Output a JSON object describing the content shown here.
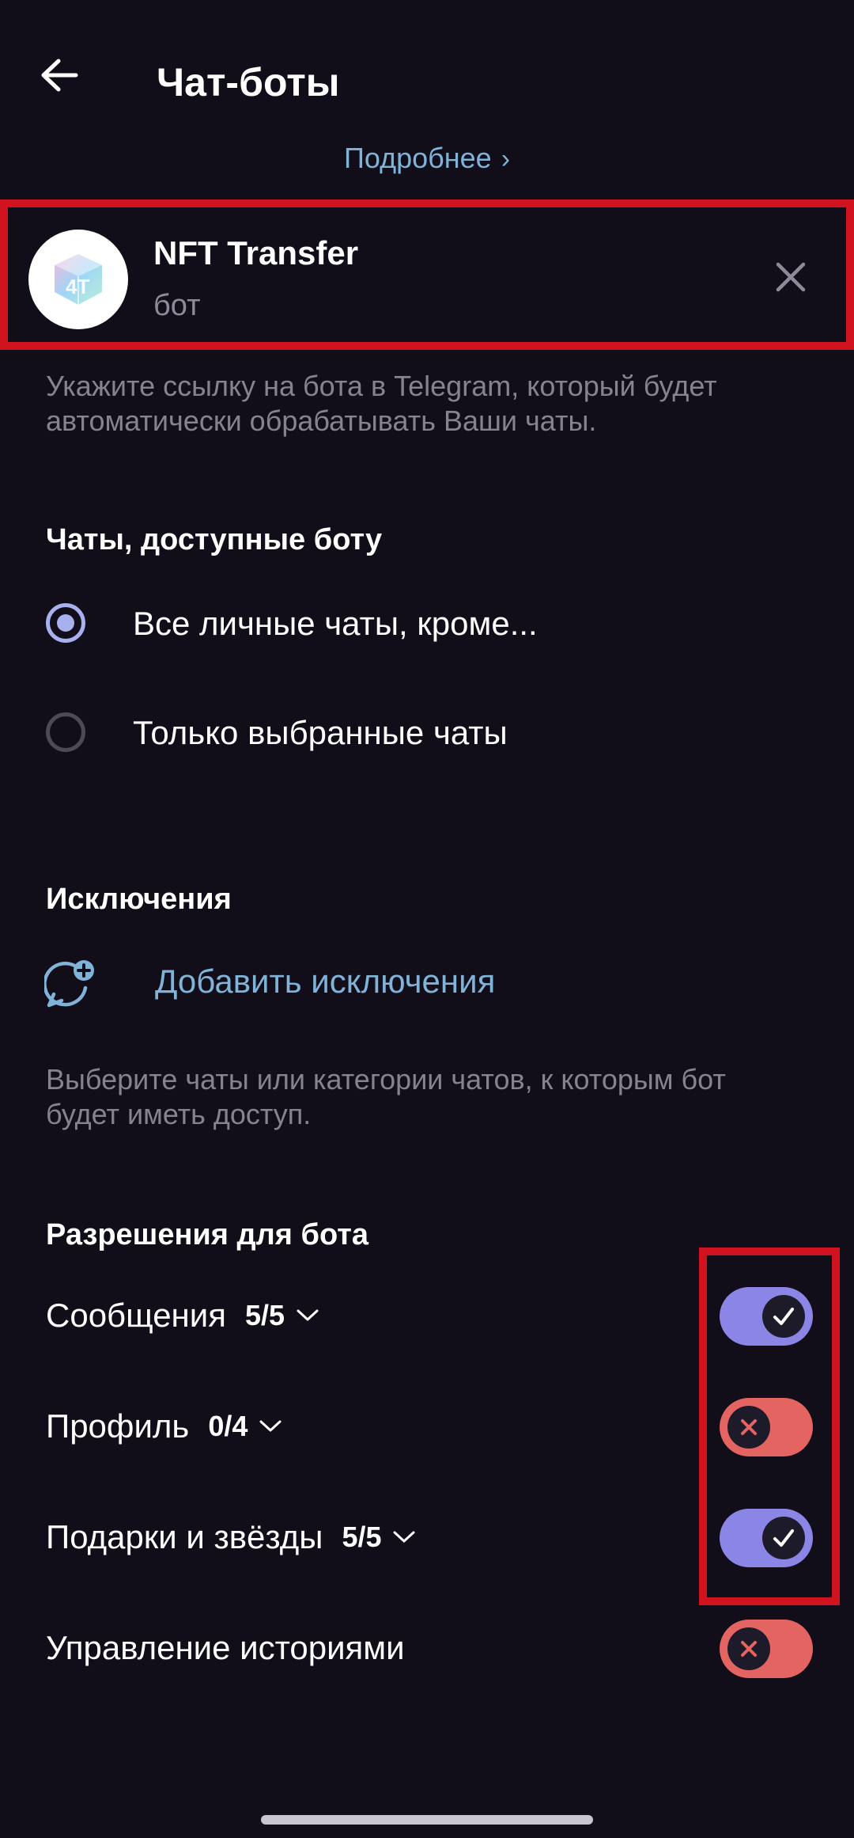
{
  "header": {
    "title": "Чат-боты",
    "more_link": "Подробнее"
  },
  "bot": {
    "name": "NFT Transfer",
    "subtitle": "бот"
  },
  "bot_hint": "Укажите ссылку на бота в Telegram, который будет автоматически обрабатывать Ваши чаты.",
  "chats_section": {
    "title": "Чаты, доступные боту",
    "options": [
      {
        "label": "Все личные чаты, кроме...",
        "selected": true
      },
      {
        "label": "Только выбранные чаты",
        "selected": false
      }
    ]
  },
  "exceptions_section": {
    "title": "Исключения",
    "add_label": "Добавить исключения",
    "hint": "Выберите чаты или категории чатов, к которым бот будет иметь доступ."
  },
  "permissions_section": {
    "title": "Разрешения для бота",
    "items": [
      {
        "label": "Сообщения",
        "count": "5/5",
        "enabled": true
      },
      {
        "label": "Профиль",
        "count": "0/4",
        "enabled": false
      },
      {
        "label": "Подарки и звёзды",
        "count": "5/5",
        "enabled": true
      },
      {
        "label": "Управление историями",
        "count": "",
        "enabled": false
      }
    ]
  },
  "colors": {
    "background": "#110d19",
    "accent_link": "#7fb3d7",
    "toggle_on": "#8b85e6",
    "toggle_off": "#e46461",
    "highlight_border": "#d0131f"
  }
}
